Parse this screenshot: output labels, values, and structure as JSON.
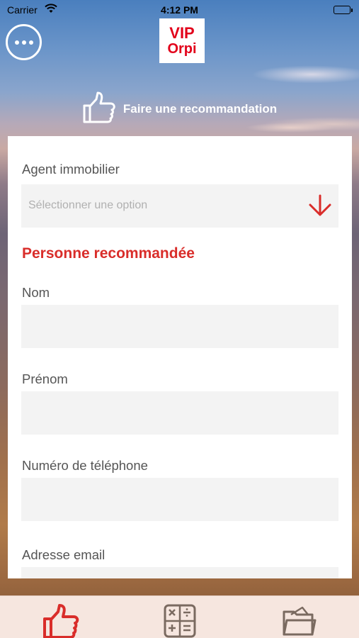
{
  "status_bar": {
    "carrier": "Carrier",
    "time": "4:12 PM"
  },
  "header": {
    "logo_line1": "VIP",
    "logo_line2": "Orpi",
    "title": "Faire une recommandation",
    "title_icon": "thumbs-up-icon",
    "menu_icon": "more-icon"
  },
  "form": {
    "agent": {
      "label": "Agent immobilier",
      "placeholder": "Sélectionner une option",
      "icon": "arrow-down-icon"
    },
    "section_title": "Personne recommandée",
    "nom": {
      "label": "Nom",
      "value": ""
    },
    "prenom": {
      "label": "Prénom",
      "value": ""
    },
    "telephone": {
      "label": "Numéro de téléphone",
      "value": ""
    },
    "email": {
      "label": "Adresse email",
      "value": ""
    }
  },
  "tabbar": {
    "tabs": [
      {
        "icon": "thumbs-up-icon",
        "active": true
      },
      {
        "icon": "calculator-icon",
        "active": false
      },
      {
        "icon": "folder-icon",
        "active": false
      }
    ]
  },
  "colors": {
    "accent": "#d92d2a",
    "brand_red": "#e2001a",
    "input_bg": "#f3f3f3",
    "tabbar_bg": "#f6e6df",
    "icon_gray": "#7a6a60"
  }
}
